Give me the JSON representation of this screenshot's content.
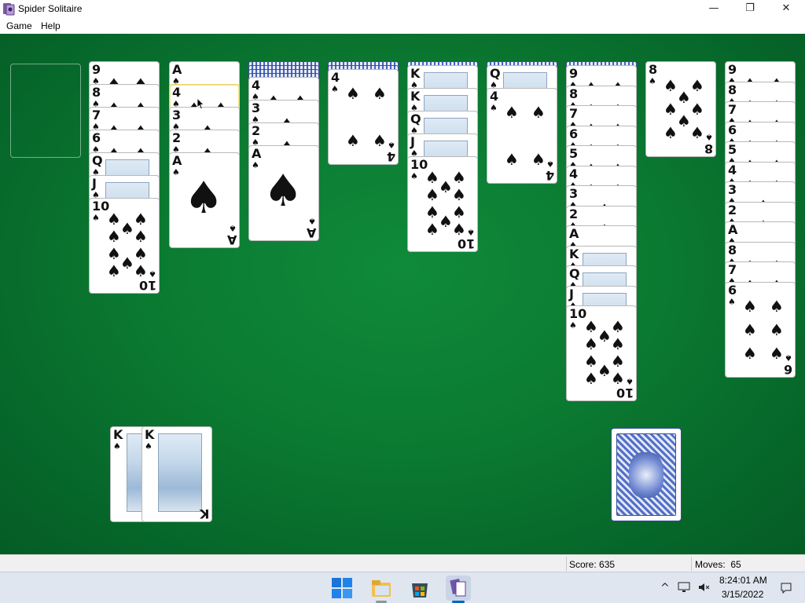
{
  "window": {
    "title": "Spider Solitaire",
    "minimize": "—",
    "restore": "❐",
    "close": "✕"
  },
  "menu": {
    "game": "Game",
    "help": "Help"
  },
  "suit_glyph": "♠",
  "tableau": [
    {
      "hidden": 0,
      "cards": [
        "9",
        "8",
        "7",
        "6",
        "Q",
        "J",
        "10"
      ]
    },
    {
      "hidden": 0,
      "cards": [
        "A",
        "4",
        "3",
        "2",
        "A"
      ]
    },
    {
      "hidden": 4,
      "cards": [
        "4",
        "3",
        "2",
        "A"
      ]
    },
    {
      "hidden": 2,
      "cards": [
        "4"
      ]
    },
    {
      "hidden": 1,
      "cards": [
        "K",
        "K",
        "Q",
        "J",
        "10"
      ]
    },
    {
      "hidden": 1,
      "cards": [
        "Q",
        "4"
      ]
    },
    {
      "hidden": 1,
      "cards": [
        "9",
        "8",
        "7",
        "6",
        "5",
        "4",
        "3",
        "2",
        "A",
        "K",
        "Q",
        "J",
        "10"
      ]
    },
    {
      "hidden": 0,
      "cards": [
        "8"
      ]
    },
    {
      "hidden": 0,
      "cards": [
        "9",
        "8",
        "7",
        "6",
        "5",
        "4",
        "3",
        "2",
        "A",
        "8",
        "7",
        "6"
      ]
    }
  ],
  "completed": [
    "K",
    "K"
  ],
  "stock_count": 1,
  "status": {
    "score": "Score: 635",
    "moves": "Moves:  65"
  },
  "taskbar": {
    "time": "8:24:01 AM",
    "date": "3/15/2022",
    "chevron": "^"
  },
  "colors": {
    "felt": "#0b7a31",
    "accent": "#0067c0"
  }
}
